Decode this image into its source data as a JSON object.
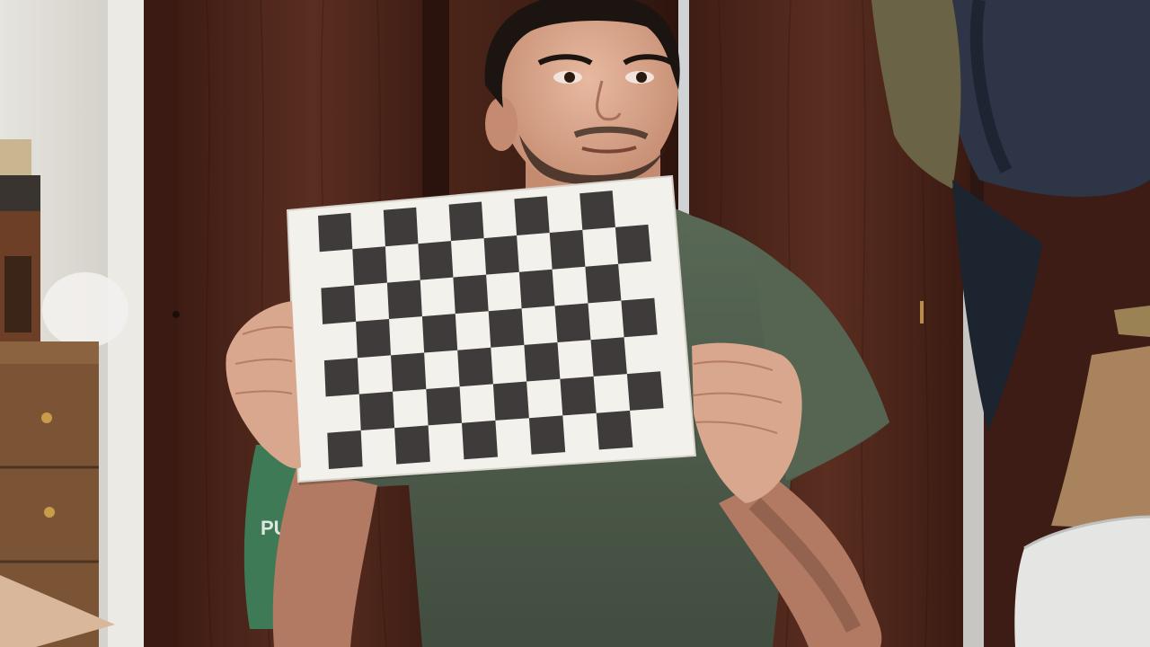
{
  "scene": {
    "description_type": "webcam-photo",
    "colors": {
      "wall": "#d9d6cf",
      "wood_door": "#4a241a",
      "wood_door_dark": "#331611",
      "skin": "#d9a78d",
      "skin_shadow": "#b67d65",
      "hair": "#1c1410",
      "shirt": "#4c5a49",
      "shirt_light": "#5f6e5c",
      "board_white": "#f3f1ec",
      "board_dark": "#3f3b3a",
      "backpack": "#2e3547",
      "drawer": "#7a5434",
      "paper_bag": "#a9835e",
      "printer": "#e5e6e4",
      "green_bag": "#3f7a57"
    },
    "checkerboard": {
      "rows": 7,
      "cols": 10
    },
    "visible_text": {
      "green_bag_letters": "PU"
    }
  }
}
